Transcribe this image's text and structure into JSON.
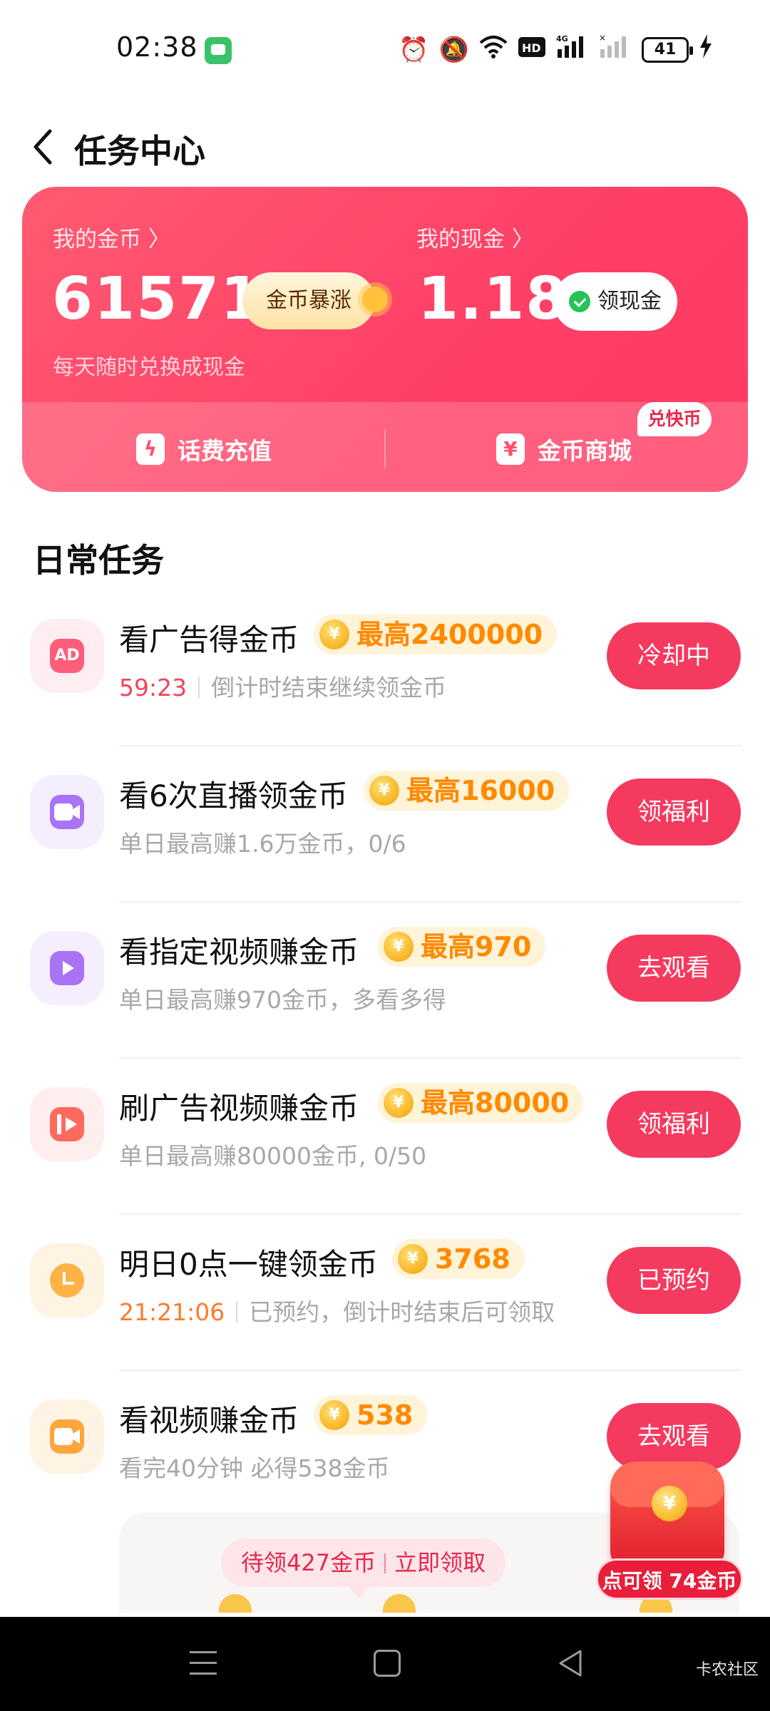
{
  "status_bar": {
    "time": "02:38",
    "battery": "41",
    "icons": [
      "message-icon",
      "alarm-icon",
      "mute-icon",
      "wifi-icon",
      "hd-icon",
      "signal-4g-icon",
      "signal-icon",
      "charging-icon"
    ]
  },
  "header": {
    "title": "任务中心",
    "back_icon": "chevron-left-icon"
  },
  "wallet": {
    "coins_label": "我的金币 〉",
    "coins_value": "61571",
    "surge_button": "金币暴涨",
    "cash_label": "我的现金 〉",
    "cash_value": "1.18",
    "withdraw_button": "领现金",
    "subtitle": "每天随时兑换成现金",
    "recharge_label": "话费充值",
    "mall_label": "金币商城",
    "mall_badge": "兑快币",
    "accent": "#ff4468"
  },
  "section_title": "日常任务",
  "tasks": [
    {
      "title": "看广告得金币",
      "reward": "最高2400000",
      "countdown": "59:23",
      "desc": "倒计时结束继续领金币",
      "button": "冷却中",
      "icon": "ad-icon",
      "icon_text": "AD"
    },
    {
      "title": "看6次直播领金币",
      "reward": "最高16000",
      "desc": "单日最高赚1.6万金币，0/6",
      "button": "领福利",
      "icon": "live-camera-icon"
    },
    {
      "title": "看指定视频赚金币",
      "reward": "最高970",
      "desc": "单日最高赚970金币，多看多得",
      "button": "去观看",
      "icon": "play-icon"
    },
    {
      "title": "刷广告视频赚金币",
      "reward": "最高80000",
      "desc": "单日最高赚80000金币, 0/50",
      "button": "领福利",
      "icon": "video-ad-icon"
    },
    {
      "title": "明日0点一键领金币",
      "reward": "3768",
      "countdown": "21:21:06",
      "desc": "已预约，倒计时结束后可领取",
      "button": "已预约",
      "icon": "clock-icon"
    },
    {
      "title": "看视频赚金币",
      "reward": "538",
      "desc": "看完40分钟 必得538金币",
      "button": "去观看",
      "icon": "video-camera-icon"
    }
  ],
  "claim": {
    "pending": "待领427金币",
    "action": "立即领取"
  },
  "float_packet": {
    "label": "点可领 74金币"
  },
  "watermark": "卡农社区"
}
